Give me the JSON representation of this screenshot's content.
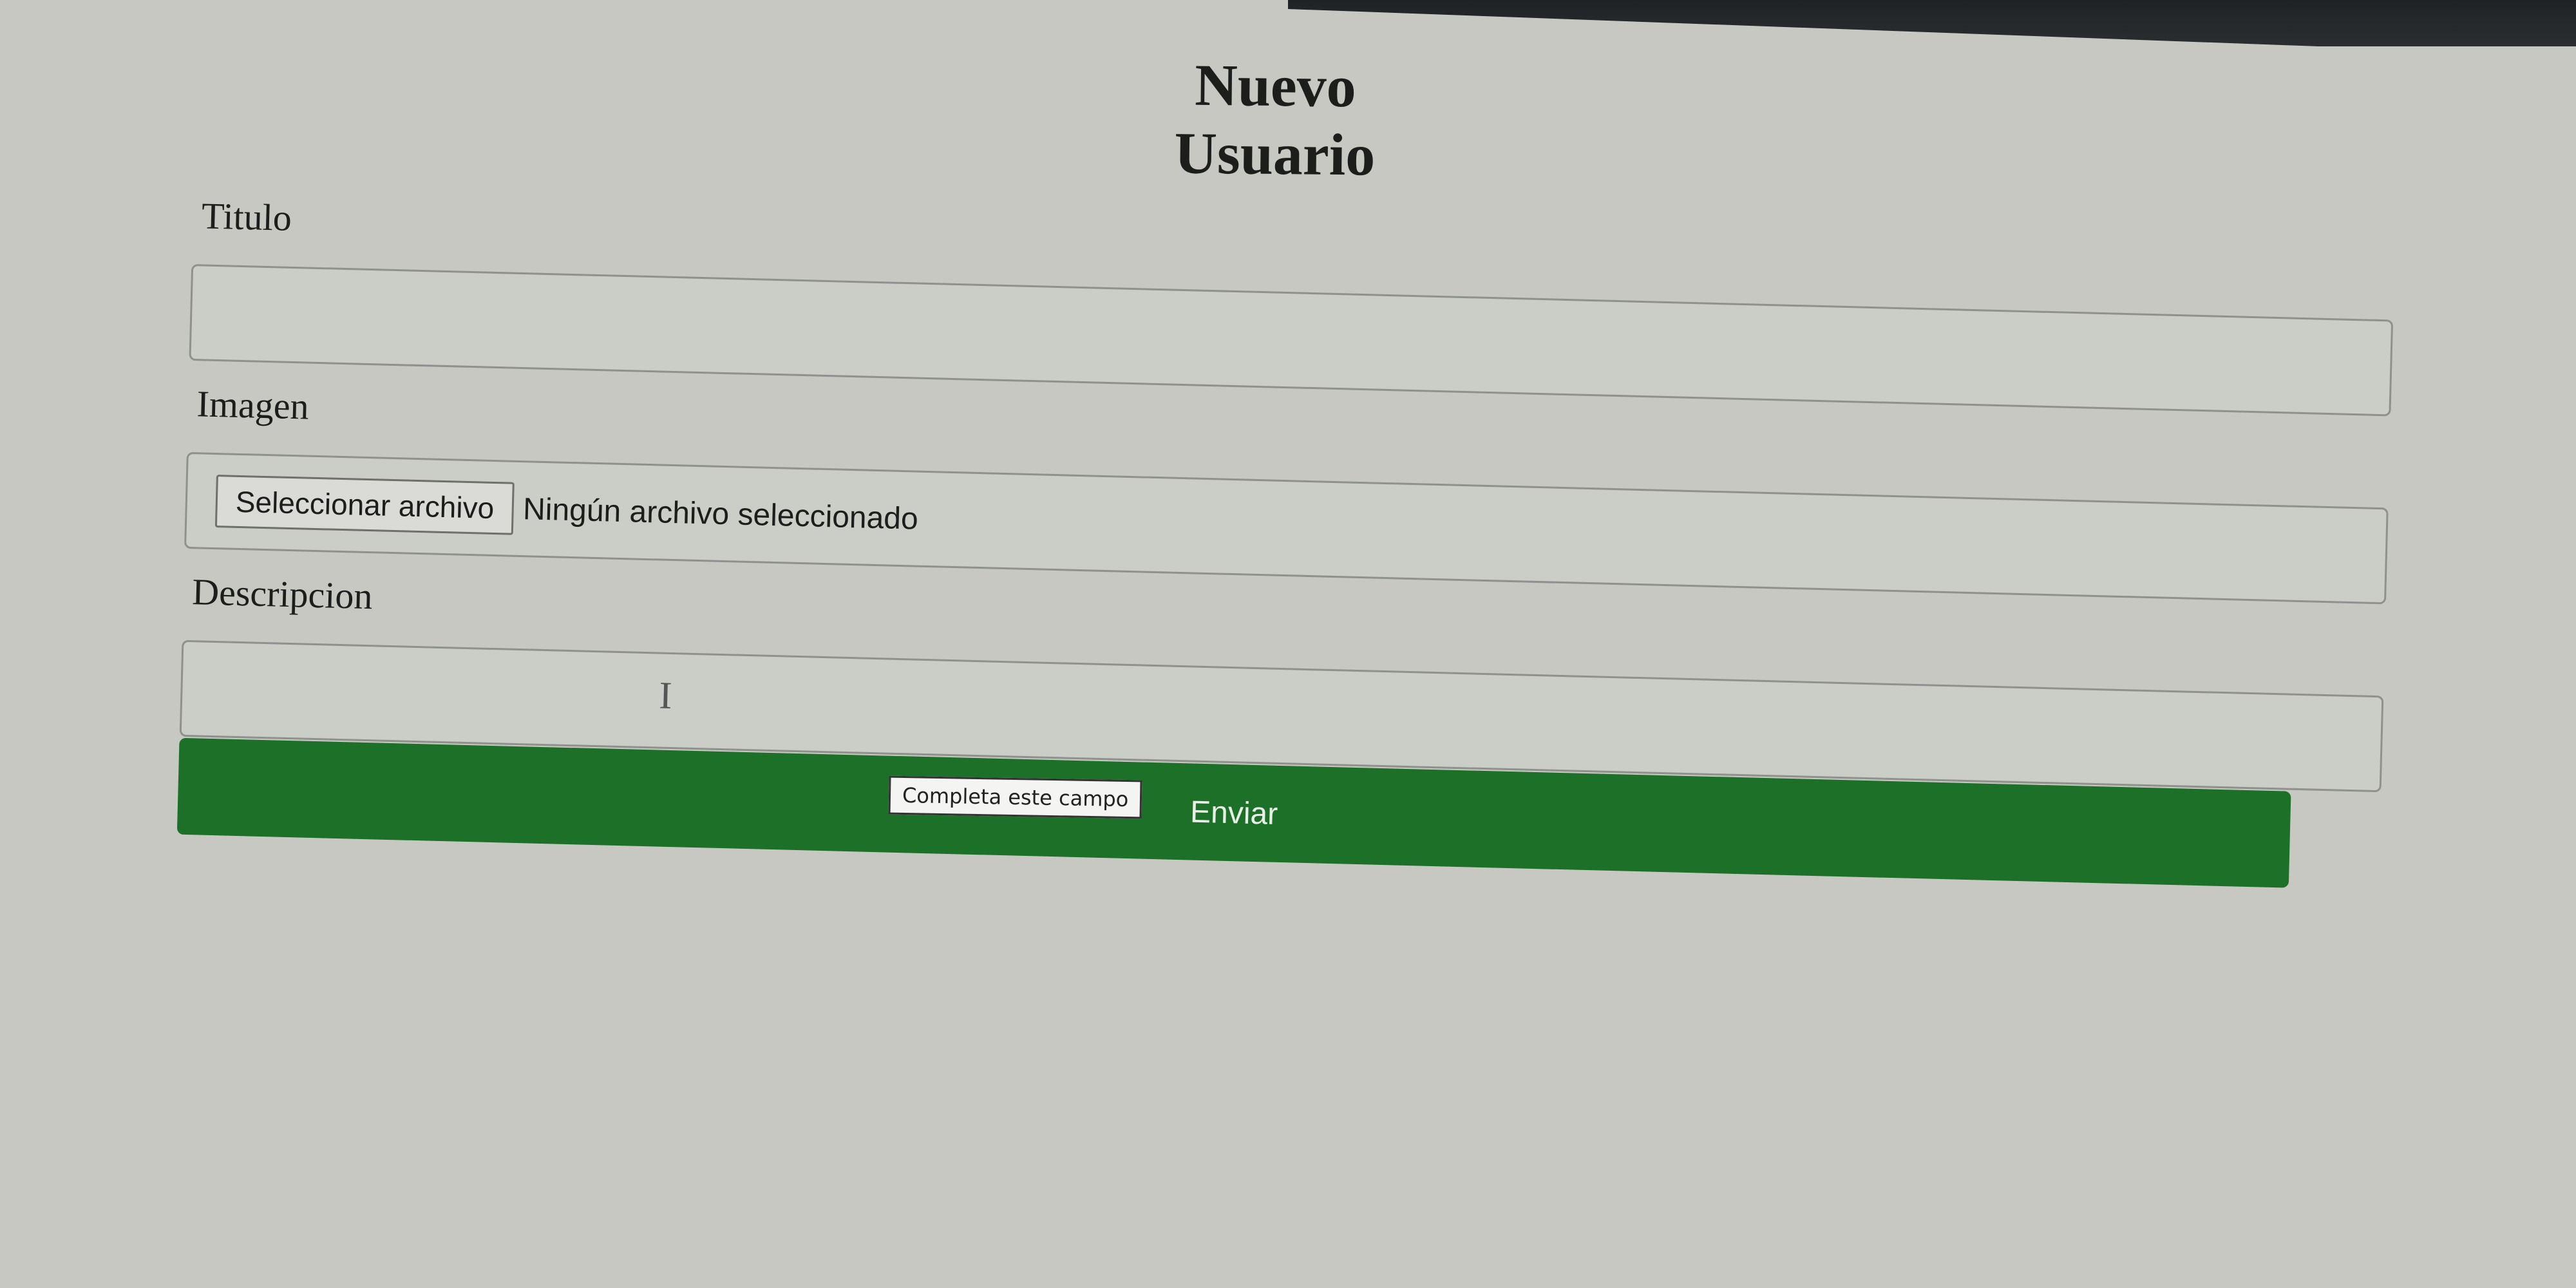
{
  "form": {
    "title": "Nuevo Usuario",
    "titulo_label": "Titulo",
    "titulo_value": "",
    "imagen_label": "Imagen",
    "file_button_label": "Seleccionar archivo",
    "file_status": "Ningún archivo seleccionado",
    "descripcion_label": "Descripcion",
    "descripcion_value": "",
    "submit_label": "Enviar"
  },
  "tooltip": {
    "text": "Completa este campo"
  },
  "colors": {
    "background": "#c7c8c2",
    "submit": "#1c7027",
    "submit_text": "#e8efe8"
  }
}
